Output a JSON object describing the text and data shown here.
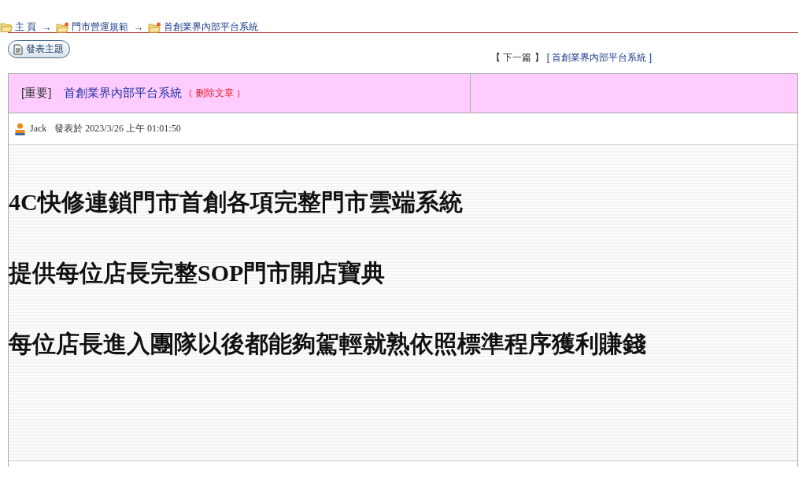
{
  "breadcrumb": [
    {
      "label": "主 頁",
      "separator": "→"
    },
    {
      "label": "門市營運規範",
      "separator": "→"
    },
    {
      "label": "首創業界內部平台系統"
    }
  ],
  "post_button": {
    "label": "發表主題"
  },
  "next_link": {
    "bracket_label": "【 下一篇 】",
    "title": "[ 首創業界內部平台系統 ]"
  },
  "topic": {
    "tag": "[重要]",
    "title": "首創業界內部平台系統",
    "delete_link": "（ 刪除文章 ）"
  },
  "author": {
    "name": "Jack",
    "posted": "發表於 2023/3/26 上午 01:01:50"
  },
  "content": [
    "4C快修連鎖門市首創各項完整門市雲端系統",
    "提供每位店長完整SOP門市開店寶典",
    "每位店長進入團隊以後都能夠駕輕就熟依照標準程序獲利賺錢"
  ]
}
